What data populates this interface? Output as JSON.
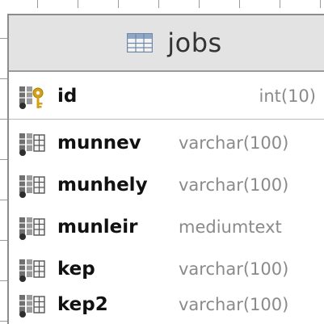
{
  "table": {
    "name": "jobs",
    "icon": "table-grid-icon"
  },
  "columns": [
    {
      "name": "id",
      "type": "int(10)",
      "key": "primary",
      "icon": "primary-key-column-icon"
    },
    {
      "name": "munnev",
      "type": "varchar(100)",
      "key": "none",
      "icon": "column-icon"
    },
    {
      "name": "munhely",
      "type": "varchar(100)",
      "key": "none",
      "icon": "column-icon"
    },
    {
      "name": "munleir",
      "type": "mediumtext",
      "key": "none",
      "icon": "column-icon"
    },
    {
      "name": "kep",
      "type": "varchar(100)",
      "key": "none",
      "icon": "column-icon"
    },
    {
      "name": "kep2",
      "type": "varchar(100)",
      "key": "none",
      "icon": "column-icon"
    }
  ],
  "colors": {
    "header_bg": "#e3e3e3",
    "border": "#8c8c8c",
    "column_name": "#111111",
    "column_type": "#8a8a8a",
    "key_icon": "#d4a017",
    "column_icon_gray": "#707070",
    "column_icon_dark": "#2e2e2e"
  }
}
